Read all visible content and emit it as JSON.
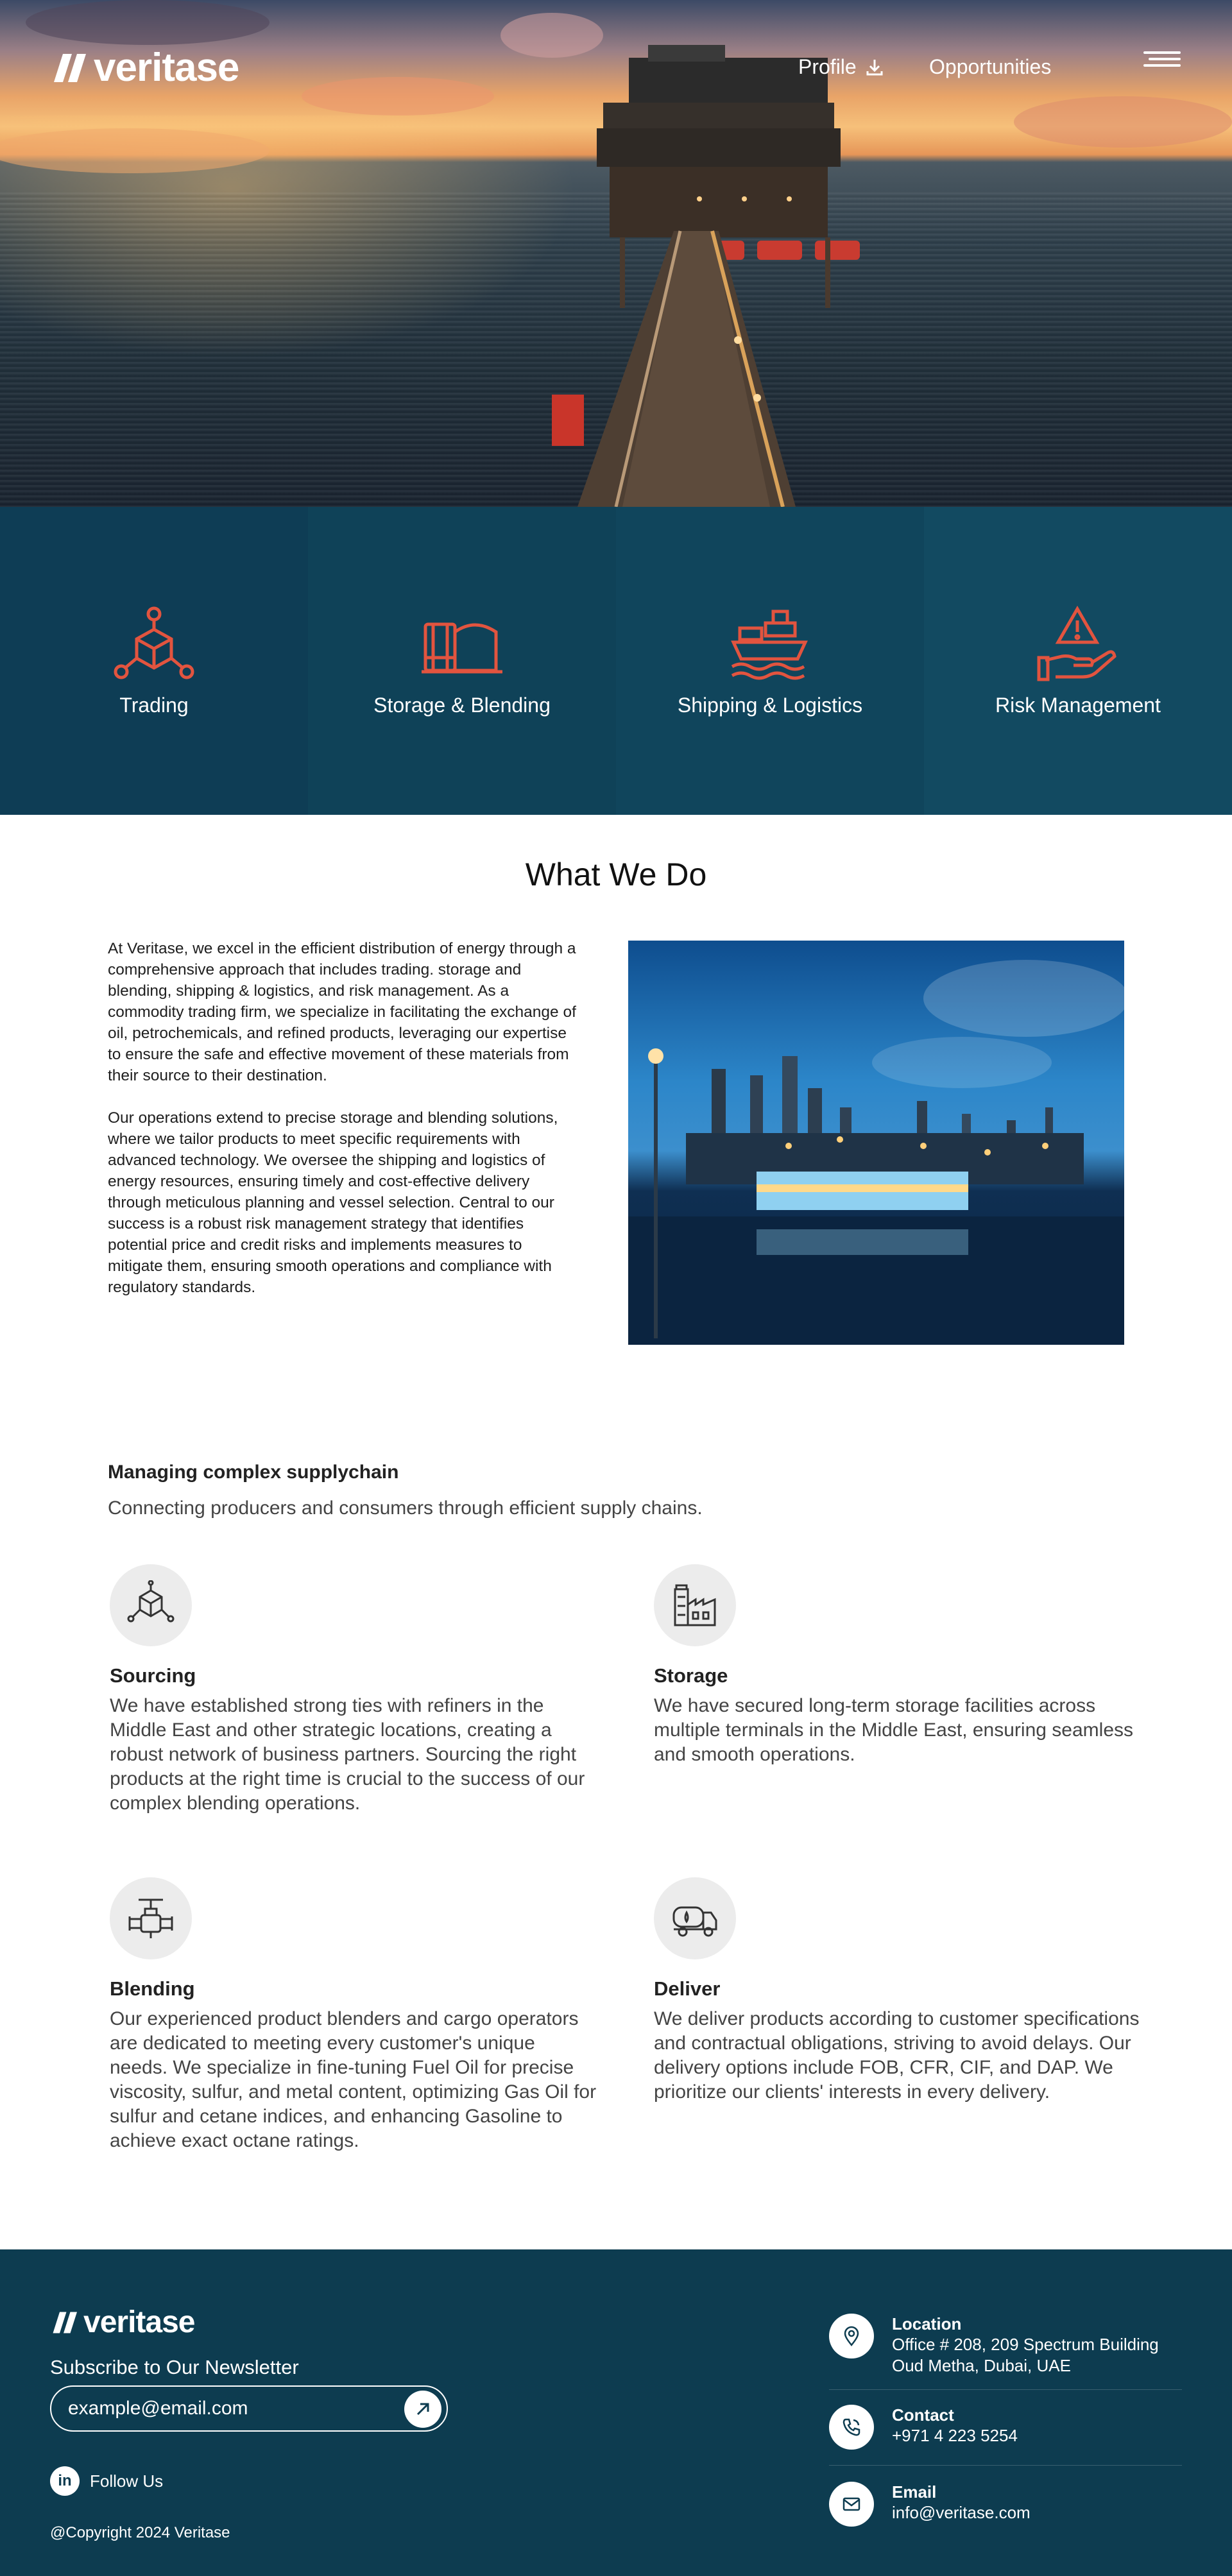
{
  "brand": {
    "name": "veritase"
  },
  "nav": {
    "profile_label": "Profile",
    "opportunities_label": "Opportunities"
  },
  "services": [
    {
      "label": "Trading",
      "icon": "network-nodes-icon"
    },
    {
      "label": "Storage & Blending",
      "icon": "storage-tanks-icon"
    },
    {
      "label": "Shipping & Logistics",
      "icon": "cargo-ship-icon"
    },
    {
      "label": "Risk Management",
      "icon": "hand-warning-icon"
    }
  ],
  "what_we_do": {
    "title": "What We Do",
    "paragraphs": [
      "At Veritase, we excel in the efficient distribution of energy through a comprehensive approach that includes trading. storage and blending, shipping & logistics, and risk management. As a commodity trading firm, we specialize in facilitating the exchange of oil, petrochemicals, and refined products, leveraging our expertise to ensure the safe and effective movement of these materials from their source to their destination.",
      "Our operations extend to precise storage and blending solutions, where we tailor products to meet specific requirements with advanced technology. We oversee the shipping and logistics of energy resources, ensuring timely and cost-effective delivery through meticulous planning and vessel selection. Central to our success is a robust risk management strategy that identifies potential price and credit risks and implements measures to mitigate them, ensuring smooth operations and compliance with regulatory standards."
    ]
  },
  "supplychain": {
    "title": "Managing complex supplychain",
    "subtitle": "Connecting producers and consumers through efficient supply chains.",
    "cards": [
      {
        "title": "Sourcing",
        "icon": "cube-network-icon",
        "body": "We have established strong ties with refiners in the Middle East and other strategic locations, creating a robust network of business partners. Sourcing the right products at the right time is crucial to the success of our complex blending operations."
      },
      {
        "title": "Storage",
        "icon": "factory-storage-icon",
        "body": "We have secured long-term storage facilities across multiple terminals in the Middle East, ensuring seamless and smooth operations."
      },
      {
        "title": "Blending",
        "icon": "pipe-valve-icon",
        "body": "Our experienced product blenders and cargo operators are dedicated to meeting every customer's unique needs. We specialize in fine-tuning Fuel Oil for precise viscosity, sulfur, and metal content, optimizing Gas Oil for sulfur and cetane indices, and enhancing Gasoline to achieve exact octane ratings."
      },
      {
        "title": "Deliver",
        "icon": "tanker-truck-icon",
        "body": "We deliver products according to customer specifications and contractual obligations, striving to avoid delays. Our delivery options include FOB, CFR, CIF, and DAP. We prioritize our clients' interests in every delivery."
      }
    ]
  },
  "footer": {
    "newsletter_label": "Subscribe to Our Newsletter",
    "email_placeholder": "example@email.com",
    "follow_label": "Follow Us",
    "copyright": "@Copyright 2024 Veritase",
    "contacts": [
      {
        "label": "Location",
        "lines": [
          "Office # 208, 209 Spectrum Building",
          "Oud Metha, Dubai, UAE"
        ],
        "icon": "location-pin-icon"
      },
      {
        "label": "Contact",
        "lines": [
          "+971 4 223 5254"
        ],
        "icon": "phone-icon"
      },
      {
        "label": "Email",
        "lines": [
          "info@veritase.com"
        ],
        "icon": "mail-icon"
      }
    ]
  },
  "colors": {
    "accent_orange": "#e2543f",
    "navy": "#0d3c50",
    "service_bg": "#0f4258"
  }
}
